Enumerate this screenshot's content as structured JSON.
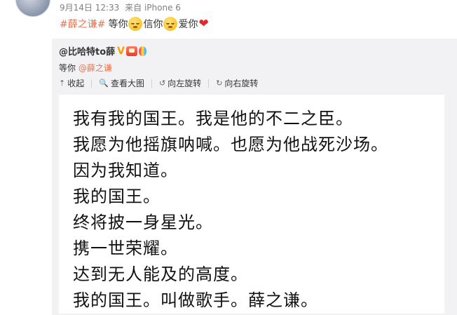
{
  "post": {
    "meta": {
      "date": "9月14日 12:33",
      "via": "来自 iPhone 6"
    },
    "hashtag": "#薛之谦#",
    "text_parts": [
      "等你",
      "信你",
      "爱你"
    ],
    "emoji": {
      "face": "emoji-face",
      "heart": "❤"
    }
  },
  "repost": {
    "author": "@比哈特to薛",
    "text": "等你",
    "mention": "@薛之谦",
    "toolbar": [
      {
        "label": "收起",
        "icon": "⇡"
      },
      {
        "label": "查看大图",
        "icon": "🔍"
      },
      {
        "label": "向左旋转",
        "icon": "↺"
      },
      {
        "label": "向右旋转",
        "icon": "↻"
      }
    ],
    "image_lines": [
      "我有我的国王。我是他的不二之臣。",
      "我愿为他摇旗呐喊。也愿为他战死沙场。",
      "因为我知道。",
      "我的国王。",
      "终将披一身星光。",
      "携一世荣耀。",
      "达到无人能及的高度。",
      "我的国王。叫做歌手。薛之谦。"
    ]
  },
  "colors": {
    "link": "#eb7350",
    "repost_bg": "#f2f2f5"
  }
}
